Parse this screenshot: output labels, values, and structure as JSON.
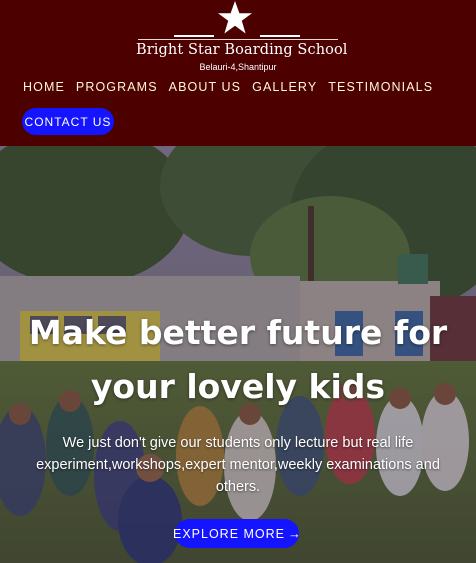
{
  "brand": {
    "name": "Bright Star Boarding School",
    "address": "Belauri-4,Shantipur",
    "logo_icon": "star-icon"
  },
  "nav": {
    "items": [
      {
        "label": "HOME"
      },
      {
        "label": "PROGRAMS"
      },
      {
        "label": "ABOUT US"
      },
      {
        "label": "GALLERY"
      },
      {
        "label": "TESTIMONIALS"
      }
    ],
    "contact_label": "CONTACT US"
  },
  "hero": {
    "title_line1": "Make better future for",
    "title_line2": "your lovely kids",
    "subtitle": "We just don't give our students only lecture but real life experiment,workshops,expert mentor,weekly examinations and others.",
    "button_label": "EXPLORE MORE",
    "button_icon": "arrow-right-icon"
  },
  "colors": {
    "header_bg": "#4d0000",
    "button_bg": "#1414ff",
    "nav_text": "#fff7d6"
  }
}
